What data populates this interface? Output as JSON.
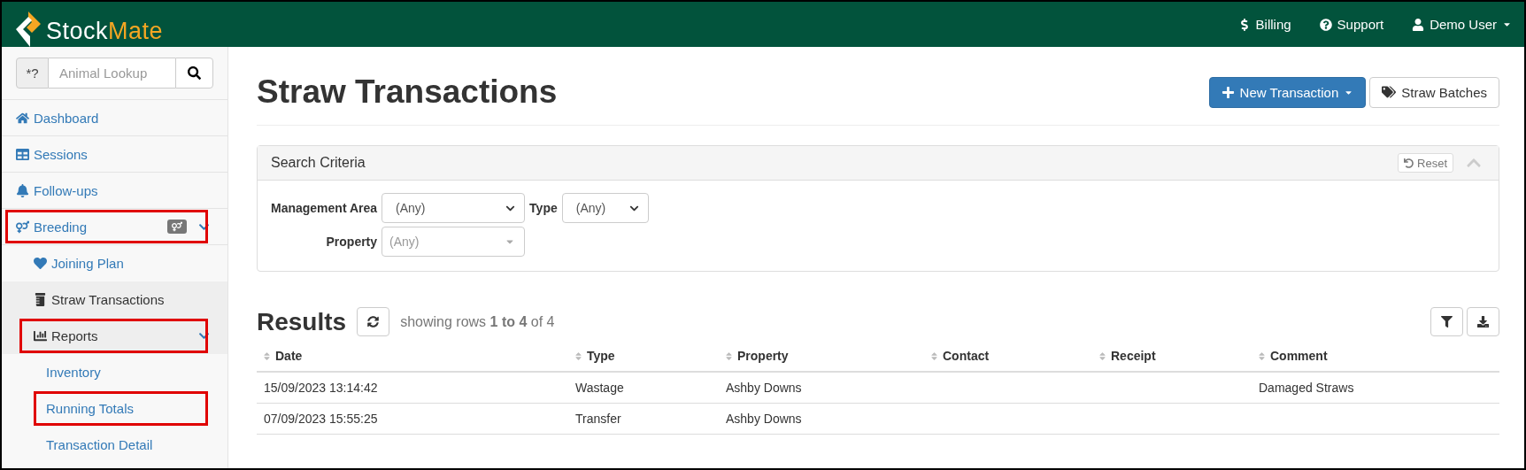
{
  "header": {
    "logo": {
      "part_1": "Stock",
      "part_2": "Mate"
    },
    "nav": [
      {
        "kind": "dollar",
        "label": "Billing",
        "dropdown": false
      },
      {
        "kind": "help",
        "label": "Support",
        "dropdown": false
      },
      {
        "kind": "user",
        "label": "Demo User",
        "dropdown": true
      }
    ]
  },
  "sidebar": {
    "search": {
      "prefix": "*?",
      "placeholder": "Animal Lookup"
    },
    "items": [
      {
        "label": "Dashboard",
        "kind": "home",
        "selected": false,
        "highlighted": false
      },
      {
        "label": "Sessions",
        "kind": "table",
        "selected": false,
        "highlighted": false
      },
      {
        "label": "Follow-ups",
        "kind": "bell",
        "selected": false,
        "highlighted": false
      },
      {
        "label": "Breeding",
        "kind": "genders",
        "badge": true,
        "selected": false,
        "highlighted": true,
        "expanded": true,
        "children": [
          {
            "label": "Joining Plan",
            "kind": "heart",
            "selected": false,
            "highlighted": false
          },
          {
            "label": "Straw Transactions",
            "kind": "bottle",
            "selected": true,
            "highlighted": false
          },
          {
            "label": "Reports",
            "kind": "chart",
            "selected": true,
            "highlighted": true,
            "expanded": true,
            "children": [
              {
                "label": "Inventory",
                "selected": false,
                "highlighted": false
              },
              {
                "label": "Running Totals",
                "selected": false,
                "highlighted": true
              },
              {
                "label": "Transaction Detail",
                "selected": false,
                "highlighted": false
              }
            ]
          }
        ]
      }
    ]
  },
  "page": {
    "title": "Straw Transactions",
    "actions": [
      {
        "kind": "primary",
        "label": "New Transaction",
        "dropdown": true
      },
      {
        "kind": "default",
        "label": "Straw Batches",
        "dropdown": false
      }
    ],
    "search_panel": {
      "title": "Search Criteria",
      "reset": "Reset",
      "expanded": true,
      "rows": [
        [
          {
            "label": "Management Area",
            "value": "(Any)",
            "disabled": false
          },
          {
            "label": "Type",
            "value": "(Any)",
            "disabled": false
          }
        ],
        [
          {
            "label": "Property",
            "placeholder": "(Any)",
            "disabled": true
          }
        ]
      ]
    },
    "results": {
      "title": "Results",
      "summary": "showing rows **1 to 4** of 4",
      "columns": [
        "Date",
        "Type",
        "Property",
        "Contact",
        "Receipt",
        "Comment"
      ],
      "rows": [
        [
          "15/09/2023 13:14:42",
          "Wastage",
          "Ashby Downs",
          "",
          "",
          "Damaged Straws"
        ],
        [
          "07/09/2023 15:55:25",
          "Transfer",
          "Ashby Downs",
          "",
          "",
          ""
        ]
      ]
    }
  }
}
